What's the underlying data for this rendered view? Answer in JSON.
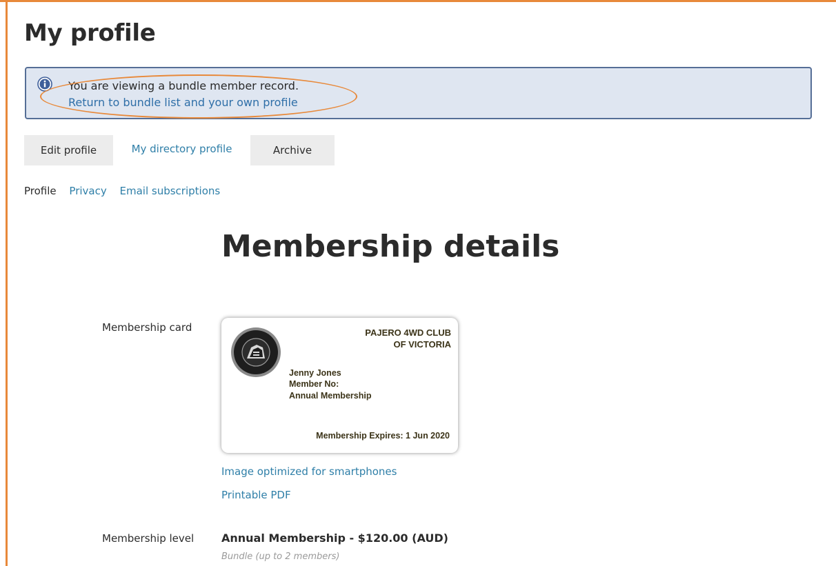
{
  "page": {
    "title": "My profile",
    "accent_color": "#e8893a",
    "link_color": "#2f7fa8"
  },
  "notice": {
    "icon": "info-icon",
    "message": "You are viewing a bundle member record.",
    "link_text": "Return to bundle list and your own profile"
  },
  "tabs": [
    {
      "label": "Edit profile",
      "active": false
    },
    {
      "label": "My directory profile",
      "active": true
    },
    {
      "label": "Archive",
      "active": false
    }
  ],
  "subnav": [
    {
      "label": "Profile",
      "current": true
    },
    {
      "label": "Privacy",
      "current": false
    },
    {
      "label": "Email subscriptions",
      "current": false
    }
  ],
  "section": {
    "title": "Membership details"
  },
  "membership_card": {
    "label": "Membership card",
    "logo_icon": "club-logo-icon",
    "club_name_line1": "PAJERO 4WD CLUB",
    "club_name_line2": "OF VICTORIA",
    "member_name": "Jenny Jones",
    "member_no": "Member No:",
    "membership_type": "Annual Membership",
    "expiry": "Membership Expires: 1 Jun 2020",
    "link_smartphone": "Image optimized for smartphones",
    "link_pdf": "Printable PDF"
  },
  "membership_level": {
    "label": "Membership level",
    "value": "Annual Membership - $120.00 (AUD)",
    "note": "Bundle (up to 2 members)"
  }
}
